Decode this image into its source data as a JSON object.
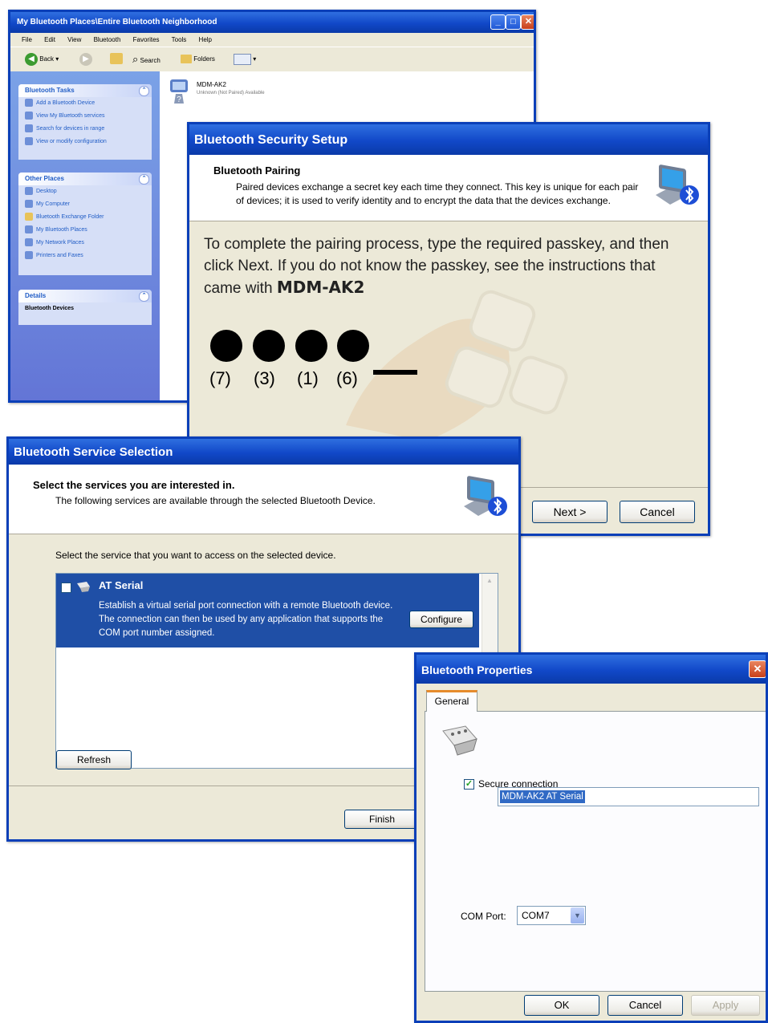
{
  "explorer": {
    "title": "My Bluetooth Places\\Entire Bluetooth Neighborhood",
    "menu": [
      "File",
      "Edit",
      "View",
      "Bluetooth",
      "Favorites",
      "Tools",
      "Help"
    ],
    "toolbar": {
      "back": "Back",
      "search": "Search",
      "folders": "Folders"
    },
    "tasks": {
      "header": "Bluetooth Tasks",
      "items": [
        "Add a Bluetooth Device",
        "View My Bluetooth services",
        "Search for devices in range",
        "View or modify configuration"
      ]
    },
    "other_places": {
      "header": "Other Places",
      "items": [
        "Desktop",
        "My Computer",
        "Bluetooth Exchange Folder",
        "My Bluetooth Places",
        "My Network Places",
        "Printers and Faxes"
      ]
    },
    "details": {
      "header": "Details",
      "value": "Bluetooth Devices"
    },
    "device": {
      "name": "MDM-AK2",
      "sub": "Unknown (Not Paired)  Available"
    }
  },
  "security": {
    "title": "Bluetooth Security Setup",
    "header_title": "Bluetooth Pairing",
    "header_sub": "Paired devices exchange a secret key each time they connect. This key is unique for each pair of devices; it is used to verify identity and to encrypt the data that the devices exchange.",
    "instruction": "To complete the pairing process, type the required passkey, and then click Next. If you do not know the passkey, see the instructions that came with",
    "device": "MDM-AK2",
    "passkey_labels": [
      "(7)",
      "(3)",
      "(1)",
      "(6)"
    ],
    "next": "Next >",
    "cancel": "Cancel"
  },
  "service": {
    "title": "Bluetooth Service Selection",
    "header_title": "Select the services you are interested in.",
    "header_sub": "The following services are available through the selected Bluetooth Device.",
    "prompt": "Select the service that you want to access on the selected device.",
    "item_name": "AT Serial",
    "item_desc": "Establish a virtual serial port connection with a remote Bluetooth device. The connection can then be used by any application that supports the COM port number assigned.",
    "configure": "Configure",
    "refresh": "Refresh",
    "finish": "Finish"
  },
  "properties": {
    "title": "Bluetooth Properties",
    "tab": "General",
    "name": "MDM-AK2 AT Serial",
    "secure_label": "Secure connection",
    "secure_checked": true,
    "com_label": "COM Port:",
    "com_value": "COM7",
    "ok": "OK",
    "cancel": "Cancel",
    "apply": "Apply"
  },
  "colors": {
    "titlebar": "#0a3fb8",
    "selection": "#1f4fa6",
    "dialog_bg": "#ece9d8"
  }
}
